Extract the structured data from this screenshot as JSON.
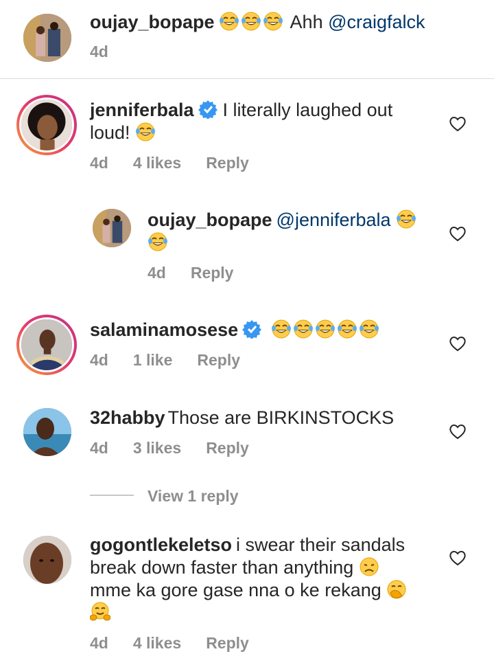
{
  "comments": [
    {
      "username": "oujay_bopape",
      "mention": "@craigfalck",
      "text_pre": "Ahh",
      "time": "4d"
    },
    {
      "username": "jenniferbala",
      "text": "I literally laughed out loud!",
      "time": "4d",
      "likes": "4 likes",
      "reply_label": "Reply"
    },
    {
      "username": "oujay_bopape",
      "mention": "@jenniferbala",
      "time": "4d",
      "reply_label": "Reply"
    },
    {
      "username": "salaminamosese",
      "time": "4d",
      "likes": "1 like",
      "reply_label": "Reply"
    },
    {
      "username": "32habby",
      "text": "Those are BIRKINSTOCKS",
      "time": "4d",
      "likes": "3 likes",
      "reply_label": "Reply"
    },
    {
      "username": "gogontlekeletso",
      "text_line1": "i swear their sandals",
      "text_line2": "break down faster than anything",
      "text_line3": "mme ka gore gase nna o ke rekang",
      "time": "4d",
      "likes": "4 likes",
      "reply_label": "Reply"
    }
  ],
  "view_replies": "View 1 reply",
  "colors": {
    "text": "#262626",
    "meta": "#8e8e8e",
    "mention": "#00376b",
    "verified": "#3897f0"
  },
  "icons": [
    "heart-outline-icon",
    "verified-badge-icon",
    "laughing-tears-emoji",
    "disappointed-emoji",
    "hand-over-mouth-emoji",
    "hugging-emoji"
  ]
}
